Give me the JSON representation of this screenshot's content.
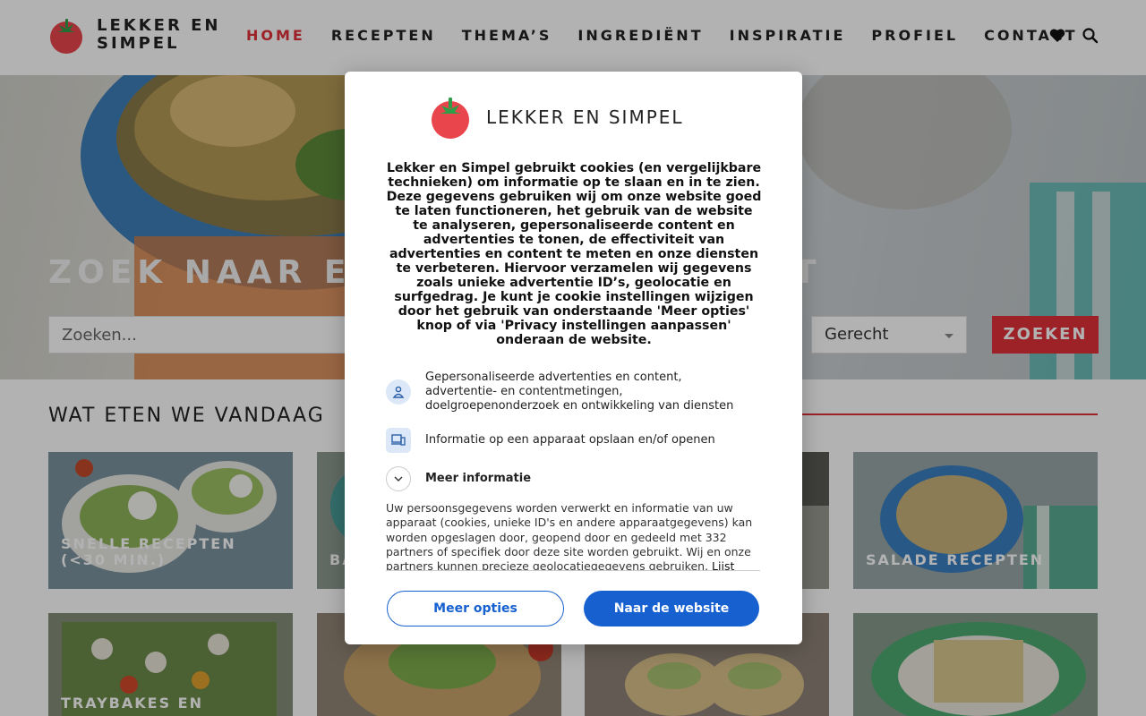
{
  "header": {
    "logo_text": "LEKKER EN SIMPEL",
    "nav": [
      {
        "label": "HOME",
        "active": true
      },
      {
        "label": "RECEPTEN"
      },
      {
        "label": "THEMA’S"
      },
      {
        "label": "INGREDIËNT"
      },
      {
        "label": "INSPIRATIE"
      },
      {
        "label": "PROFIEL"
      },
      {
        "label": "CONTACT"
      }
    ],
    "icons": [
      "heart-icon",
      "search-icon"
    ]
  },
  "hero": {
    "title": "ZOEK NAAR EEN LEKKER GERECHT",
    "search_placeholder": "Zoeken...",
    "select_value": "Gerecht",
    "search_button": "ZOEKEN"
  },
  "section": {
    "title": "WAT ETEN WE VANDAAG",
    "cards": [
      {
        "label": "SNELLE RECEPTEN (<30 MIN.)"
      },
      {
        "label": "BA"
      },
      {
        "label": ""
      },
      {
        "label": "SALADE RECEPTEN"
      },
      {
        "label": "TRAYBAKES EN"
      },
      {
        "label": ""
      },
      {
        "label": ""
      },
      {
        "label": ""
      }
    ]
  },
  "consent": {
    "logo_text": "LEKKER EN SIMPEL",
    "intro": "Lekker en Simpel gebruikt cookies (en vergelijkbare technieken) om informatie op te slaan en in te zien. Deze gegevens gebruiken wij om onze website goed te laten functioneren, het gebruik van de website te analyseren, gepersonaliseerde content en advertenties te tonen, de effectiviteit van advertenties en content te meten en onze diensten te verbeteren. Hiervoor verzamelen wij gegevens zoals unieke advertentie ID’s, geolocatie en surfgedrag. Je kunt je cookie instellingen wijzigen door het gebruik van onderstaande 'Meer opties' knop of via 'Privacy instellingen aanpassen' onderaan de website.",
    "purposes": [
      "Gepersonaliseerde advertenties en content, advertentie- en contentmetingen, doelgroepenonderzoek en ontwikkeling van diensten",
      "Informatie op een apparaat opslaan en/of openen"
    ],
    "more_info": "Meer informatie",
    "details": "Uw persoonsgegevens worden verwerkt en informatie van uw apparaat (cookies, unieke ID's en andere apparaatgegevens) kan worden opgeslagen door, geopend door en gedeeld met 332 partners of specifiek door deze site worden gebruikt. Wij en onze partners kunnen precieze geolocatiegegevens gebruiken.",
    "details_link": "Lijst met",
    "btn_more_options": "Meer opties",
    "btn_continue": "Naar de website",
    "colors": {
      "primary": "#1660d0",
      "brand_red": "#e0323a"
    }
  }
}
